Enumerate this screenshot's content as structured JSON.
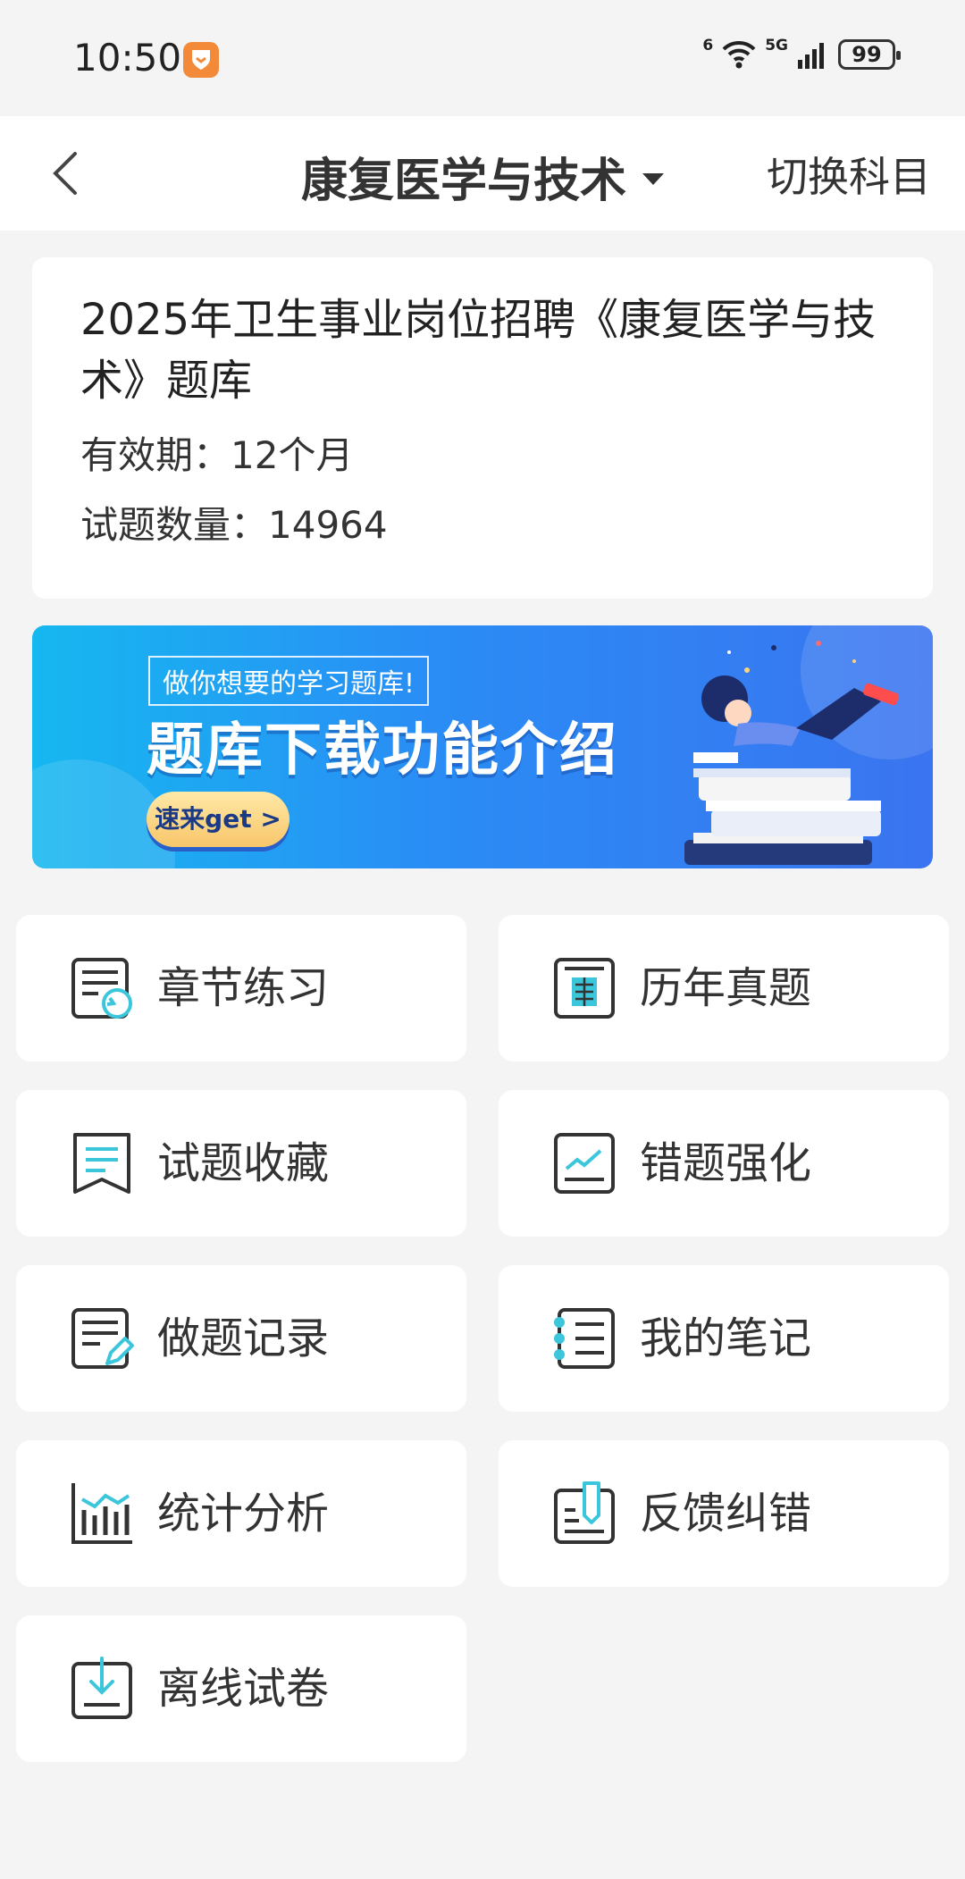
{
  "status": {
    "time": "10:50",
    "wifi_label": "6",
    "cell_label": "5G",
    "battery": "99"
  },
  "nav": {
    "title": "康复医学与技术",
    "switch_label": "切换科目"
  },
  "info": {
    "title": "2025年卫生事业岗位招聘《康复医学与技术》题库",
    "validity": "有效期：12个月",
    "count": "试题数量：14964"
  },
  "banner": {
    "tag": "做你想要的学习题库!",
    "headline": "题库下载功能介绍",
    "cta": "速来get >"
  },
  "menu": [
    {
      "label": "章节练习",
      "icon": "chapter-practice-icon"
    },
    {
      "label": "历年真题",
      "icon": "past-papers-icon"
    },
    {
      "label": "试题收藏",
      "icon": "favorites-icon"
    },
    {
      "label": "错题强化",
      "icon": "wrong-questions-icon"
    },
    {
      "label": "做题记录",
      "icon": "history-icon"
    },
    {
      "label": "我的笔记",
      "icon": "notes-icon"
    },
    {
      "label": "统计分析",
      "icon": "statistics-icon"
    },
    {
      "label": "反馈纠错",
      "icon": "feedback-icon"
    },
    {
      "label": "离线试卷",
      "icon": "offline-download-icon"
    }
  ],
  "colors": {
    "accent": "#3cc6dc",
    "background": "#f4f4f4",
    "banner_start": "#16b8f0",
    "banner_end": "#3a74f0"
  }
}
